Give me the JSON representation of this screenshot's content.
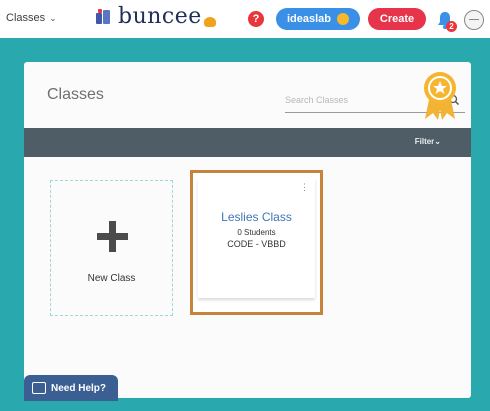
{
  "topbar": {
    "classes_menu_label": "Classes",
    "brand_name": "buncee",
    "help_icon_glyph": "?",
    "ideaslab_label": "ideaslab",
    "create_label": "Create",
    "notification_count": "2"
  },
  "main": {
    "title": "Classes",
    "search_placeholder": "Search Classes",
    "filter_label": "Filter",
    "new_class_label": "New Class",
    "class_card": {
      "name": "Leslies Class",
      "students": "0 Students",
      "code": "CODE - VBBD"
    }
  },
  "help_button": {
    "label": "Need Help?"
  },
  "colors": {
    "background_teal": "#29a8ad",
    "filter_bar": "#4f5e66",
    "ideaslab_blue": "#3a8fe6",
    "create_red": "#e6344a",
    "class_card_border": "#c6833c",
    "help_button": "#3b5f93"
  }
}
